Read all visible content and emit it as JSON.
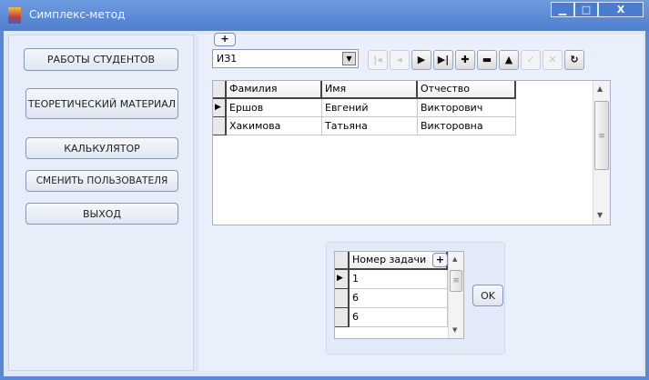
{
  "window": {
    "title": "Симплекс-метод",
    "minimize": "▁",
    "maximize": "□",
    "close": "X"
  },
  "sidebar": {
    "buttons": [
      {
        "label": "РАБОТЫ СТУДЕНТОВ"
      },
      {
        "label": "ТЕОРЕТИЧЕСКИЙ МАТЕРИАЛ"
      },
      {
        "label": "КАЛЬКУЛЯТОР"
      },
      {
        "label": "СМЕНИТЬ ПОЛЬЗОВАТЕЛЯ"
      },
      {
        "label": "ВЫХОД"
      }
    ]
  },
  "main": {
    "expand_label": "+",
    "group_select": {
      "value": "ИЗ1"
    },
    "navigator": [
      {
        "icon": "first-icon",
        "glyph": "|◂",
        "enabled": false
      },
      {
        "icon": "prior-icon",
        "glyph": "◂",
        "enabled": false
      },
      {
        "icon": "next-icon",
        "glyph": "▶",
        "enabled": true
      },
      {
        "icon": "last-icon",
        "glyph": "▶|",
        "enabled": true
      },
      {
        "icon": "insert-icon",
        "glyph": "✚",
        "enabled": true
      },
      {
        "icon": "delete-icon",
        "glyph": "▬",
        "enabled": true
      },
      {
        "icon": "edit-icon",
        "glyph": "▲",
        "enabled": true
      },
      {
        "icon": "post-icon",
        "glyph": "✓",
        "enabled": false
      },
      {
        "icon": "cancel-icon",
        "glyph": "✕",
        "enabled": false
      },
      {
        "icon": "refresh-icon",
        "glyph": "↻",
        "enabled": true
      }
    ],
    "students": {
      "columns": [
        "Фамилия",
        "Имя",
        "Отчество"
      ],
      "rows": [
        [
          "Ершов",
          "Евгений",
          "Викторович"
        ],
        [
          "Хакимова",
          "Татьяна",
          "Викторовна"
        ]
      ]
    },
    "tasks": {
      "column": "Номер задачи",
      "add_label": "+",
      "rows": [
        "1",
        "6",
        "6"
      ],
      "ok_label": "OK"
    }
  }
}
